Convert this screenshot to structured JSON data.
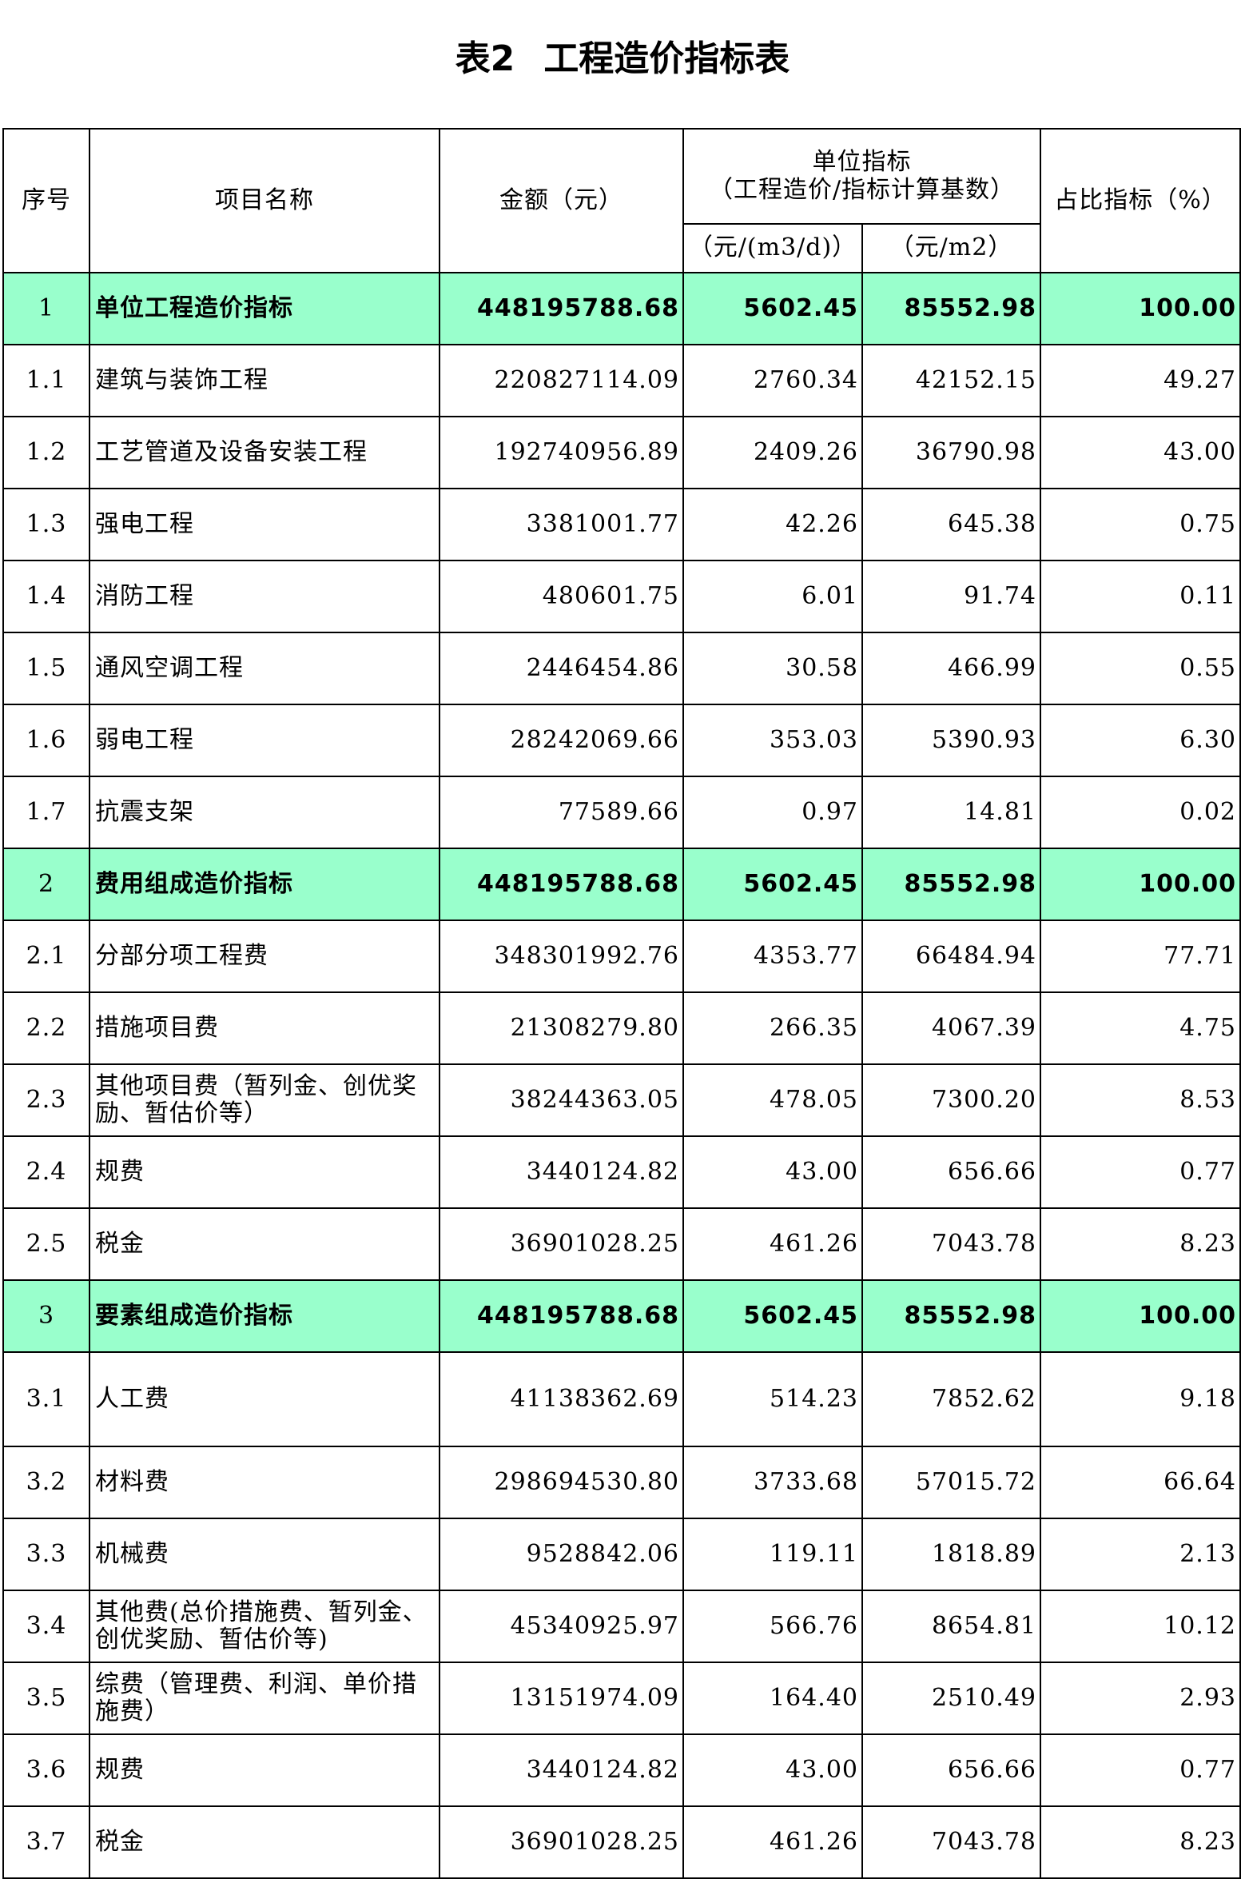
{
  "title": {
    "prefix": "表2",
    "main": "工程造价指标表"
  },
  "header": {
    "seq": "序号",
    "name": "项目名称",
    "amount": "金额（元）",
    "unit_index_line1": "单位指标",
    "unit_index_line2": "（工程造价/指标计算基数）",
    "unit_per_m3d": "（元/(m3/d)）",
    "unit_per_m2": "（元/m2）",
    "ratio": "占比指标（%）"
  },
  "colors": {
    "section_row_bg": "#99ffcc",
    "border": "#000000"
  },
  "rows": [
    {
      "seq": "1",
      "name": "单位工程造价指标",
      "amount": "448195788.68",
      "per_m3d": "5602.45",
      "per_m2": "85552.98",
      "ratio": "100.00",
      "section": true
    },
    {
      "seq": "1.1",
      "name": "建筑与装饰工程",
      "amount": "220827114.09",
      "per_m3d": "2760.34",
      "per_m2": "42152.15",
      "ratio": "49.27",
      "section": false
    },
    {
      "seq": "1.2",
      "name": "工艺管道及设备安装工程",
      "amount": "192740956.89",
      "per_m3d": "2409.26",
      "per_m2": "36790.98",
      "ratio": "43.00",
      "section": false
    },
    {
      "seq": "1.3",
      "name": "强电工程",
      "amount": "3381001.77",
      "per_m3d": "42.26",
      "per_m2": "645.38",
      "ratio": "0.75",
      "section": false
    },
    {
      "seq": "1.4",
      "name": "消防工程",
      "amount": "480601.75",
      "per_m3d": "6.01",
      "per_m2": "91.74",
      "ratio": "0.11",
      "section": false
    },
    {
      "seq": "1.5",
      "name": "通风空调工程",
      "amount": "2446454.86",
      "per_m3d": "30.58",
      "per_m2": "466.99",
      "ratio": "0.55",
      "section": false
    },
    {
      "seq": "1.6",
      "name": "弱电工程",
      "amount": "28242069.66",
      "per_m3d": "353.03",
      "per_m2": "5390.93",
      "ratio": "6.30",
      "section": false
    },
    {
      "seq": "1.7",
      "name": "抗震支架",
      "amount": "77589.66",
      "per_m3d": "0.97",
      "per_m2": "14.81",
      "ratio": "0.02",
      "section": false
    },
    {
      "seq": "2",
      "name": "费用组成造价指标",
      "amount": "448195788.68",
      "per_m3d": "5602.45",
      "per_m2": "85552.98",
      "ratio": "100.00",
      "section": true
    },
    {
      "seq": "2.1",
      "name": "分部分项工程费",
      "amount": "348301992.76",
      "per_m3d": "4353.77",
      "per_m2": "66484.94",
      "ratio": "77.71",
      "section": false
    },
    {
      "seq": "2.2",
      "name": "措施项目费",
      "amount": "21308279.80",
      "per_m3d": "266.35",
      "per_m2": "4067.39",
      "ratio": "4.75",
      "section": false
    },
    {
      "seq": "2.3",
      "name": "其他项目费（暂列金、创优奖励、暂估价等）",
      "amount": "38244363.05",
      "per_m3d": "478.05",
      "per_m2": "7300.20",
      "ratio": "8.53",
      "section": false
    },
    {
      "seq": "2.4",
      "name": "规费",
      "amount": "3440124.82",
      "per_m3d": "43.00",
      "per_m2": "656.66",
      "ratio": "0.77",
      "section": false
    },
    {
      "seq": "2.5",
      "name": "税金",
      "amount": "36901028.25",
      "per_m3d": "461.26",
      "per_m2": "7043.78",
      "ratio": "8.23",
      "section": false
    },
    {
      "seq": "3",
      "name": "要素组成造价指标",
      "amount": "448195788.68",
      "per_m3d": "5602.45",
      "per_m2": "85552.98",
      "ratio": "100.00",
      "section": true
    },
    {
      "seq": "3.1",
      "name": "人工费",
      "amount": "41138362.69",
      "per_m3d": "514.23",
      "per_m2": "7852.62",
      "ratio": "9.18",
      "section": false
    },
    {
      "seq": "3.2",
      "name": "材料费",
      "amount": "298694530.80",
      "per_m3d": "3733.68",
      "per_m2": "57015.72",
      "ratio": "66.64",
      "section": false
    },
    {
      "seq": "3.3",
      "name": "机械费",
      "amount": "9528842.06",
      "per_m3d": "119.11",
      "per_m2": "1818.89",
      "ratio": "2.13",
      "section": false
    },
    {
      "seq": "3.4",
      "name": "其他费(总价措施费、暂列金、创优奖励、暂估价等)",
      "amount": "45340925.97",
      "per_m3d": "566.76",
      "per_m2": "8654.81",
      "ratio": "10.12",
      "section": false
    },
    {
      "seq": "3.5",
      "name": "综费（管理费、利润、单价措施费）",
      "amount": "13151974.09",
      "per_m3d": "164.40",
      "per_m2": "2510.49",
      "ratio": "2.93",
      "section": false
    },
    {
      "seq": "3.6",
      "name": "规费",
      "amount": "3440124.82",
      "per_m3d": "43.00",
      "per_m2": "656.66",
      "ratio": "0.77",
      "section": false
    },
    {
      "seq": "3.7",
      "name": "税金",
      "amount": "36901028.25",
      "per_m3d": "461.26",
      "per_m2": "7043.78",
      "ratio": "8.23",
      "section": false
    }
  ]
}
